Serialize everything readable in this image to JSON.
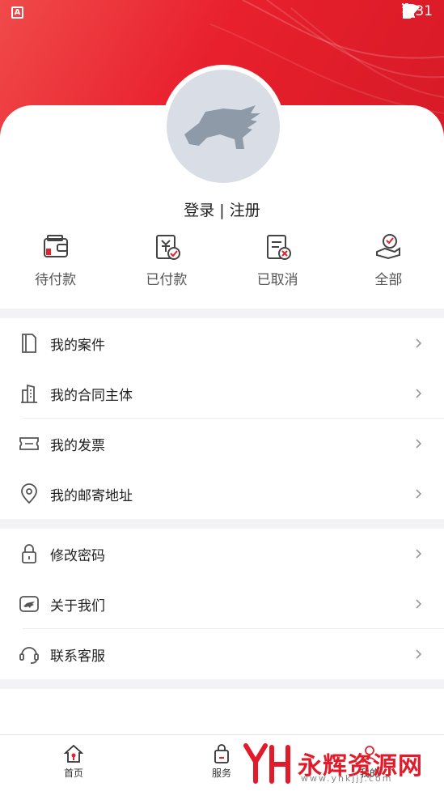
{
  "status_bar": {
    "time": "4:31",
    "left_icon": "A"
  },
  "profile": {
    "login_label": "登录 | 注册",
    "avatar_icon": "horse-logo-icon"
  },
  "orders": [
    {
      "label": "待付款",
      "icon": "wallet-icon"
    },
    {
      "label": "已付款",
      "icon": "paid-receipt-icon"
    },
    {
      "label": "已取消",
      "icon": "cancelled-receipt-icon"
    },
    {
      "label": "全部",
      "icon": "all-orders-icon"
    }
  ],
  "menu_group_1": [
    {
      "label": "我的案件",
      "icon": "document-icon"
    },
    {
      "label": "我的合同主体",
      "icon": "building-icon"
    },
    {
      "label": "我的发票",
      "icon": "ticket-icon"
    },
    {
      "label": "我的邮寄地址",
      "icon": "location-pin-icon"
    }
  ],
  "menu_group_2": [
    {
      "label": "修改密码",
      "icon": "lock-icon"
    },
    {
      "label": "关于我们",
      "icon": "info-horse-icon"
    },
    {
      "label": "联系客服",
      "icon": "headset-icon"
    }
  ],
  "tabbar": [
    {
      "label": "首页",
      "icon": "home-icon"
    },
    {
      "label": "服务",
      "icon": "bag-icon"
    },
    {
      "label": "我的",
      "icon": "user-icon"
    }
  ],
  "watermark": {
    "text": "永辉资源网",
    "url": "www.yhkjjj.com"
  },
  "colors": {
    "accent": "#e8202d",
    "background_gap": "#f3f3f5",
    "avatar_bg": "#d9dee6"
  }
}
